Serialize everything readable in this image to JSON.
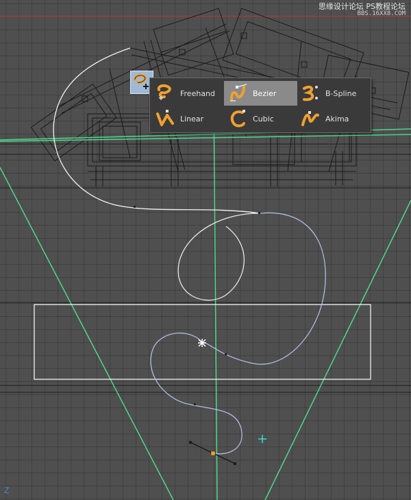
{
  "watermark": {
    "line1": "思缘设计论坛  PS教程论坛",
    "line2": "BBS.16XX8.COM"
  },
  "viewport": {
    "axis_label": "Z"
  },
  "tool": {
    "icon": "bezier-pen-icon"
  },
  "spline_menu": {
    "items": [
      {
        "label": "Freehand",
        "icon": "freehand-spline-icon",
        "active": false
      },
      {
        "label": "Bezier",
        "icon": "bezier-spline-icon",
        "active": true
      },
      {
        "label": "B-Spline",
        "icon": "b-spline-icon",
        "active": false
      },
      {
        "label": "Linear",
        "icon": "linear-spline-icon",
        "active": false
      },
      {
        "label": "Cubic",
        "icon": "cubic-spline-icon",
        "active": false
      },
      {
        "label": "Akima",
        "icon": "akima-spline-icon",
        "active": false
      }
    ]
  },
  "colors": {
    "background": "#4f4f4f",
    "grid": "#3e3e3e",
    "camera_frustum": "#4fd88c",
    "spline": "#aebfe6",
    "spline_selected": "#ffffff",
    "cursor": "#2de3c9",
    "point_handle": "#f2a623",
    "icon_orange": "#f0a030",
    "menu_active": "#8a8a8a",
    "tool_button": "#9fb9d6"
  }
}
